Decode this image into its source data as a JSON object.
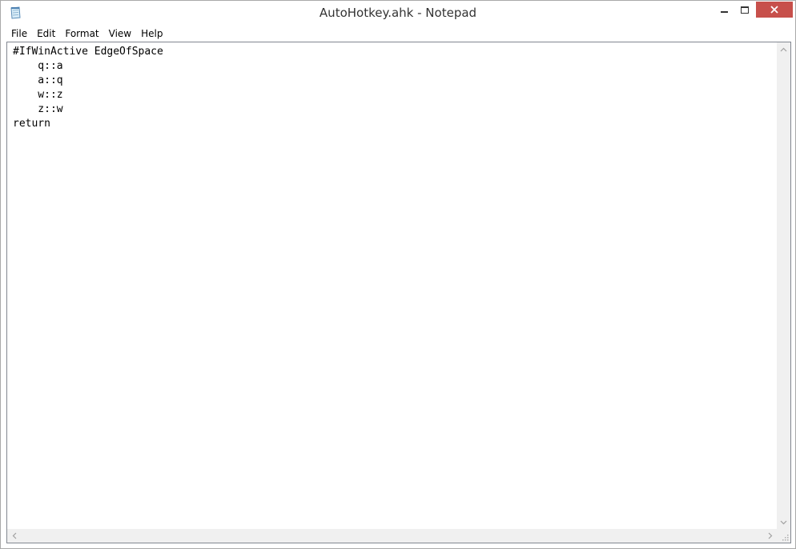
{
  "window": {
    "title": "AutoHotkey.ahk - Notepad",
    "icon": "notepad-icon",
    "close_color": "#c7504b"
  },
  "menu": {
    "items": [
      {
        "label": "File"
      },
      {
        "label": "Edit"
      },
      {
        "label": "Format"
      },
      {
        "label": "View"
      },
      {
        "label": "Help"
      }
    ]
  },
  "editor": {
    "content": "#IfWinActive EdgeOfSpace\n    q::a\n    a::q\n    w::z\n    z::w\nreturn"
  },
  "scrollbars": {
    "up_icon": "chevron-up-icon",
    "down_icon": "chevron-down-icon",
    "left_icon": "chevron-left-icon",
    "right_icon": "chevron-right-icon"
  }
}
